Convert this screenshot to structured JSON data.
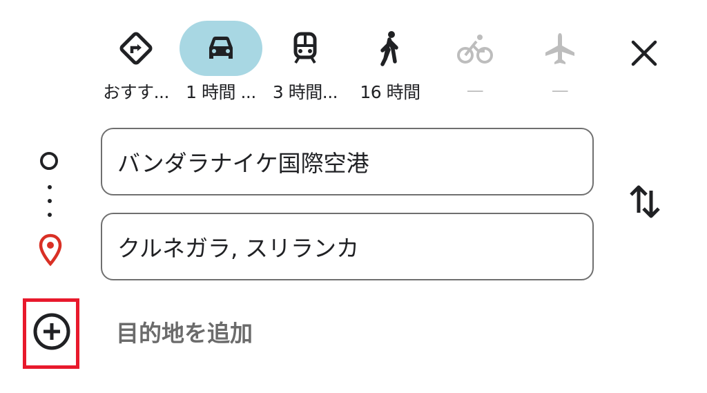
{
  "travel_modes": [
    {
      "name": "recommended",
      "icon": "directions-diamond-icon",
      "label": "おすす..."
    },
    {
      "name": "driving",
      "icon": "car-icon",
      "label": "1 時間 ..."
    },
    {
      "name": "transit",
      "icon": "train-icon",
      "label": "3 時間..."
    },
    {
      "name": "walking",
      "icon": "walking-icon",
      "label": "16 時間"
    },
    {
      "name": "cycling",
      "icon": "bicycle-icon",
      "label": "—"
    },
    {
      "name": "flight",
      "icon": "airplane-icon",
      "label": "—"
    }
  ],
  "selected_mode": "driving",
  "route": {
    "origin": "バンダラナイケ国際空港",
    "destination": "クルネガラ, スリランカ"
  },
  "add_destination_label": "目的地を追加",
  "colors": {
    "selected_pill": "#a8d7e3",
    "pin": "#d93025",
    "highlight_box": "#e8192c",
    "disabled_icon": "#bdbdbd"
  }
}
